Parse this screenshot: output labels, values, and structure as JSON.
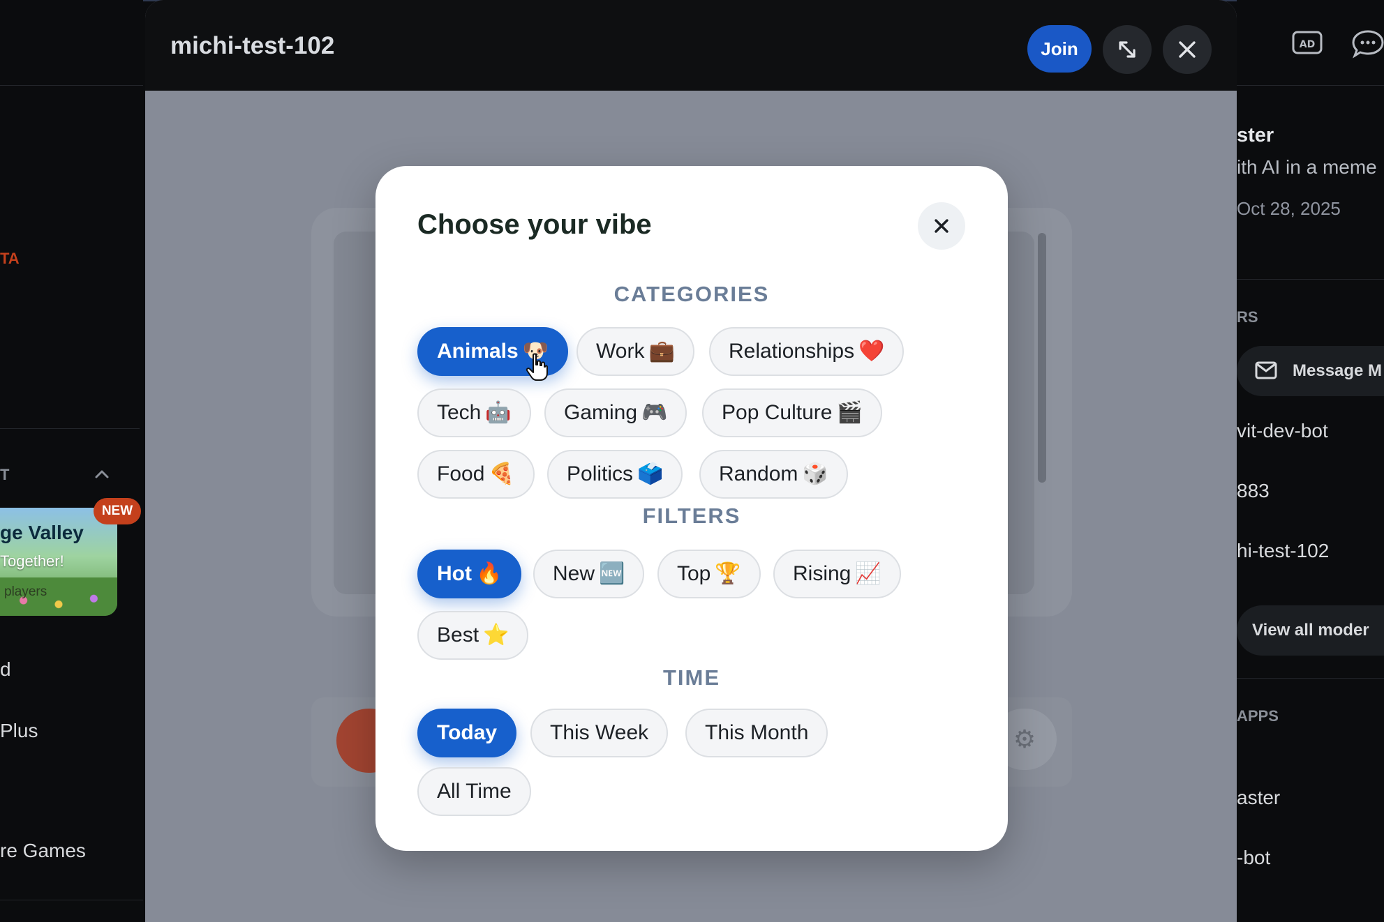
{
  "left_sidebar": {
    "beta_label": "TA",
    "section_label": "T",
    "featured": {
      "badge": "NEW",
      "title": "ge Valley",
      "subtitle": "Together!",
      "players": "players"
    },
    "items": [
      "d",
      "Plus",
      "re Games"
    ]
  },
  "game_window": {
    "title": "michi-test-102",
    "join_label": "Join"
  },
  "right_sidebar": {
    "app_name": "ster",
    "app_desc": "ith AI in a meme",
    "date": "Oct 28, 2025",
    "moderators_heading": "RS",
    "message_button": "Message M",
    "moderators": [
      "vit-dev-bot",
      "883",
      "hi-test-102"
    ],
    "view_all": "View all moder",
    "apps_heading": "APPS",
    "apps": [
      "aster",
      "-bot"
    ]
  },
  "modal": {
    "title": "Choose your vibe",
    "categories_heading": "CATEGORIES",
    "filters_heading": "FILTERS",
    "time_heading": "TIME",
    "categories": [
      {
        "label": "Animals",
        "emoji": "🐶",
        "selected": true
      },
      {
        "label": "Work",
        "emoji": "💼",
        "selected": false
      },
      {
        "label": "Relationships",
        "emoji": "❤️",
        "selected": false
      },
      {
        "label": "Tech",
        "emoji": "🤖",
        "selected": false
      },
      {
        "label": "Gaming",
        "emoji": "🎮",
        "selected": false
      },
      {
        "label": "Pop Culture",
        "emoji": "🎬",
        "selected": false
      },
      {
        "label": "Food",
        "emoji": "🍕",
        "selected": false
      },
      {
        "label": "Politics",
        "emoji": "🗳️",
        "selected": false
      },
      {
        "label": "Random",
        "emoji": "🎲",
        "selected": false
      }
    ],
    "filters": [
      {
        "label": "Hot",
        "emoji": "🔥",
        "selected": true
      },
      {
        "label": "New",
        "emoji": "🆕",
        "selected": false
      },
      {
        "label": "Top",
        "emoji": "🏆",
        "selected": false
      },
      {
        "label": "Rising",
        "emoji": "📈",
        "selected": false
      },
      {
        "label": "Best",
        "emoji": "⭐",
        "selected": false
      }
    ],
    "time": [
      {
        "label": "Today",
        "selected": true
      },
      {
        "label": "This Week",
        "selected": false
      },
      {
        "label": "This Month",
        "selected": false
      },
      {
        "label": "All Time",
        "selected": false
      }
    ]
  },
  "colors": {
    "accent": "#1760cc",
    "join_button": "#1a58c6",
    "new_badge": "#c4401c",
    "heading": "#6a7d97"
  }
}
